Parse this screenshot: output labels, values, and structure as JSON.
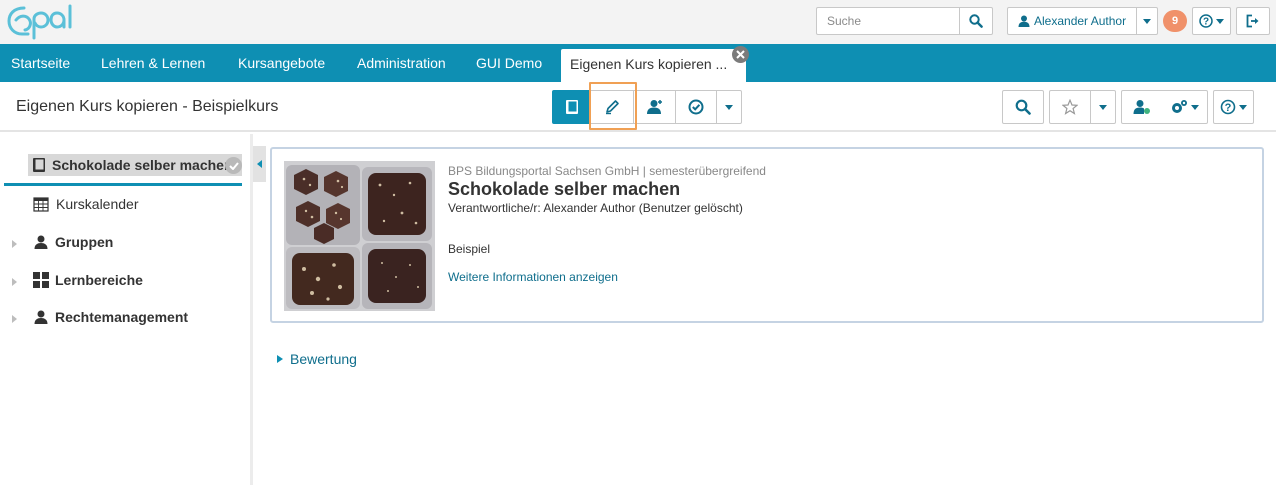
{
  "header": {
    "search_placeholder": "Suche",
    "user_name": "Alexander Author",
    "notification_count": "9"
  },
  "nav": {
    "items": [
      "Startseite",
      "Lehren & Lernen",
      "Kursangebote",
      "Administration",
      "GUI Demo"
    ],
    "active_tab": "Eigenen Kurs kopieren ..."
  },
  "toolbar": {
    "page_title": "Eigenen Kurs kopieren - Beispielkurs"
  },
  "sidebar": {
    "active_item": "Schokolade selber machen",
    "items": [
      {
        "label": "Kurskalender",
        "icon": "calendar-icon"
      },
      {
        "label": "Gruppen",
        "icon": "group-icon"
      },
      {
        "label": "Lernbereiche",
        "icon": "grid-icon"
      },
      {
        "label": "Rechtemanagement",
        "icon": "rights-icon"
      }
    ]
  },
  "course": {
    "institution": "BPS Bildungsportal Sachsen GmbH | semesterübergreifend",
    "title": "Schokolade selber machen",
    "responsible": "Verantwortliche/r: Alexander Author (Benutzer gelöscht)",
    "description": "Beispiel",
    "more_info_link": "Weitere Informationen anzeigen"
  },
  "evaluation": {
    "label": "Bewertung"
  },
  "colors": {
    "brand": "#0e8fb3",
    "link": "#0f6e8c",
    "badge": "#f0916a",
    "highlight": "#f0a054"
  }
}
